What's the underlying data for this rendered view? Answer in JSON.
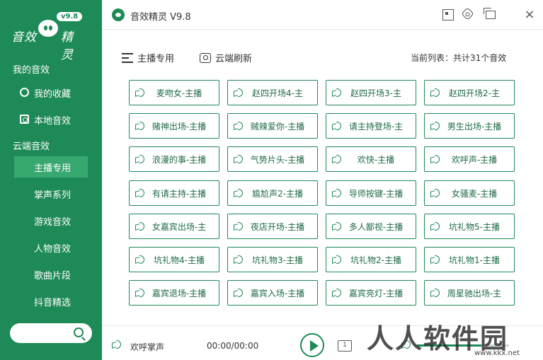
{
  "app": {
    "title": "音效精灵 V9.8",
    "logo_text_left": "音效",
    "logo_text_right": "精灵",
    "logo_version": "v9.8"
  },
  "sidebar": {
    "my_section": "我的音效",
    "my_items": [
      {
        "label": "我的收藏",
        "icon": "star-icon"
      },
      {
        "label": "本地音效",
        "icon": "disk-icon"
      }
    ],
    "cloud_section": "云端音效",
    "cloud_items": [
      {
        "label": "主播专用",
        "active": true
      },
      {
        "label": "掌声系列",
        "active": false
      },
      {
        "label": "游戏音效",
        "active": false
      },
      {
        "label": "人物音效",
        "active": false
      },
      {
        "label": "歌曲片段",
        "active": false
      },
      {
        "label": "抖音精选",
        "active": false
      }
    ],
    "search_placeholder": ""
  },
  "toolbar": {
    "anchor_label": "主播专用",
    "refresh_label": "云端刷新",
    "list_count": "当前列表：共计31个音效"
  },
  "sounds": [
    "麦吻女-主播",
    "赵四开场4-主",
    "赵四开场3-主",
    "赵四开场2-主",
    "赌神出场-主播",
    "贼辣爱你-主播",
    "请主持登场-主",
    "男生出场-主播",
    "浪漫的事-主播",
    "气势片头-主播",
    "欢快-主播",
    "欢呼声-主播",
    "有请主持-主播",
    "尴尬声2-主播",
    "导师按键-主播",
    "女骚麦-主播",
    "女嘉宾出场-主",
    "夜店开场-主播",
    "多人鄙视-主播",
    "坑礼物5-主播",
    "坑礼物4-主播",
    "坑礼物3-主播",
    "坑礼物2-主播",
    "坑礼物1-主播",
    "嘉宾退场-主播",
    "嘉宾入场-主播",
    "嘉宾亮灯-主播",
    "周星驰出场-主"
  ],
  "player": {
    "now_playing": "欢呼掌声",
    "time": "00:00/00:00",
    "volume": 0.7
  },
  "watermark": {
    "text": "人人软件园",
    "url": "www.kkx.net"
  },
  "colors": {
    "accent": "#1e8a57",
    "sidebar_active": "#38a871"
  }
}
